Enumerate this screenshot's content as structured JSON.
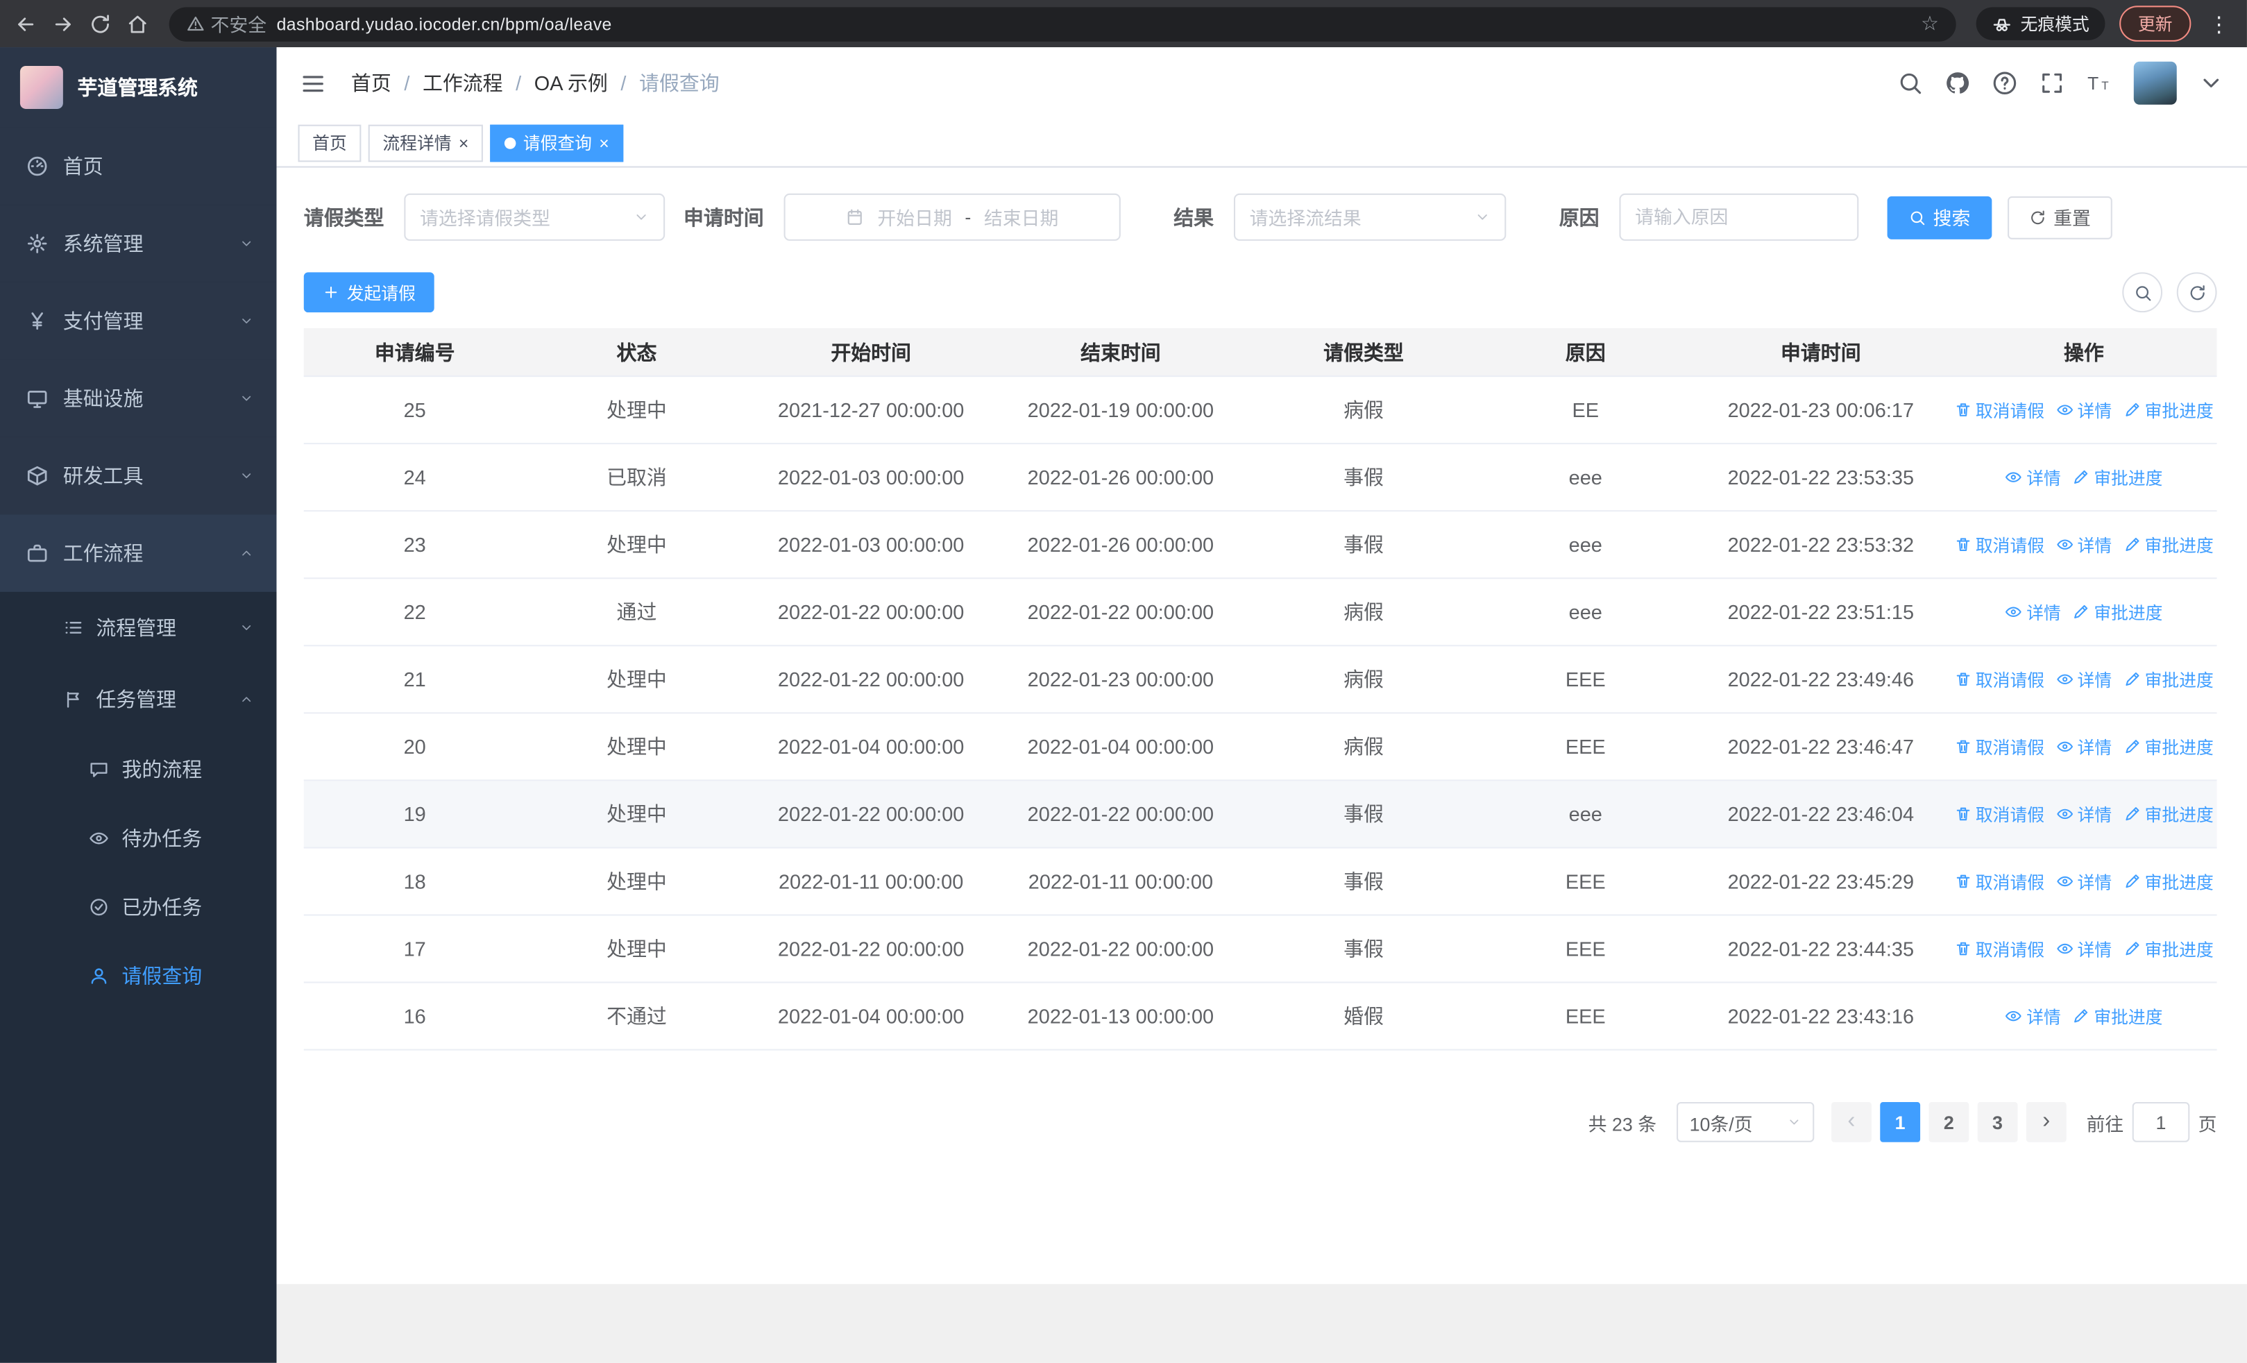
{
  "browser": {
    "security_label": "不安全",
    "url": "dashboard.yudao.iocoder.cn/bpm/oa/leave",
    "incognito_label": "无痕模式",
    "update_label": "更新"
  },
  "sidebar": {
    "logo_title": "芋道管理系统",
    "items": [
      {
        "label": "首页"
      },
      {
        "label": "系统管理"
      },
      {
        "label": "支付管理"
      },
      {
        "label": "基础设施"
      },
      {
        "label": "研发工具"
      },
      {
        "label": "工作流程"
      }
    ],
    "submenu": {
      "process_mgmt": "流程管理",
      "task_mgmt": "任务管理",
      "my_process": "我的流程",
      "todo_tasks": "待办任务",
      "done_tasks": "已办任务",
      "leave_query": "请假查询"
    }
  },
  "header": {
    "breadcrumb": [
      "首页",
      "工作流程",
      "OA 示例",
      "请假查询"
    ],
    "separator": "/"
  },
  "tabs": [
    {
      "label": "首页"
    },
    {
      "label": "流程详情"
    },
    {
      "label": "请假查询"
    }
  ],
  "filters": {
    "leave_type_label": "请假类型",
    "leave_type_placeholder": "请选择请假类型",
    "apply_time_label": "申请时间",
    "start_date_placeholder": "开始日期",
    "date_separator": "-",
    "end_date_placeholder": "结束日期",
    "result_label": "结果",
    "result_placeholder": "请选择流结果",
    "reason_label": "原因",
    "reason_placeholder": "请输入原因",
    "search_label": "搜索",
    "reset_label": "重置"
  },
  "toolbar": {
    "create_label": "发起请假"
  },
  "table": {
    "columns": [
      "申请编号",
      "状态",
      "开始时间",
      "结束时间",
      "请假类型",
      "原因",
      "申请时间",
      "操作"
    ],
    "action_labels": {
      "cancel": "取消请假",
      "detail": "详情",
      "progress": "审批进度"
    },
    "rows": [
      {
        "id": "25",
        "status": "处理中",
        "start": "2021-12-27 00:00:00",
        "end": "2022-01-19 00:00:00",
        "type": "病假",
        "reason": "EE",
        "applied": "2022-01-23 00:06:17",
        "cancelable": true,
        "highlight": false
      },
      {
        "id": "24",
        "status": "已取消",
        "start": "2022-01-03 00:00:00",
        "end": "2022-01-26 00:00:00",
        "type": "事假",
        "reason": "eee",
        "applied": "2022-01-22 23:53:35",
        "cancelable": false,
        "highlight": false
      },
      {
        "id": "23",
        "status": "处理中",
        "start": "2022-01-03 00:00:00",
        "end": "2022-01-26 00:00:00",
        "type": "事假",
        "reason": "eee",
        "applied": "2022-01-22 23:53:32",
        "cancelable": true,
        "highlight": false
      },
      {
        "id": "22",
        "status": "通过",
        "start": "2022-01-22 00:00:00",
        "end": "2022-01-22 00:00:00",
        "type": "病假",
        "reason": "eee",
        "applied": "2022-01-22 23:51:15",
        "cancelable": false,
        "highlight": false
      },
      {
        "id": "21",
        "status": "处理中",
        "start": "2022-01-22 00:00:00",
        "end": "2022-01-23 00:00:00",
        "type": "病假",
        "reason": "EEE",
        "applied": "2022-01-22 23:49:46",
        "cancelable": true,
        "highlight": false
      },
      {
        "id": "20",
        "status": "处理中",
        "start": "2022-01-04 00:00:00",
        "end": "2022-01-04 00:00:00",
        "type": "病假",
        "reason": "EEE",
        "applied": "2022-01-22 23:46:47",
        "cancelable": true,
        "highlight": false
      },
      {
        "id": "19",
        "status": "处理中",
        "start": "2022-01-22 00:00:00",
        "end": "2022-01-22 00:00:00",
        "type": "事假",
        "reason": "eee",
        "applied": "2022-01-22 23:46:04",
        "cancelable": true,
        "highlight": true
      },
      {
        "id": "18",
        "status": "处理中",
        "start": "2022-01-11 00:00:00",
        "end": "2022-01-11 00:00:00",
        "type": "事假",
        "reason": "EEE",
        "applied": "2022-01-22 23:45:29",
        "cancelable": true,
        "highlight": false
      },
      {
        "id": "17",
        "status": "处理中",
        "start": "2022-01-22 00:00:00",
        "end": "2022-01-22 00:00:00",
        "type": "事假",
        "reason": "EEE",
        "applied": "2022-01-22 23:44:35",
        "cancelable": true,
        "highlight": false
      },
      {
        "id": "16",
        "status": "不通过",
        "start": "2022-01-04 00:00:00",
        "end": "2022-01-13 00:00:00",
        "type": "婚假",
        "reason": "EEE",
        "applied": "2022-01-22 23:43:16",
        "cancelable": false,
        "highlight": false
      }
    ]
  },
  "pagination": {
    "total": "共 23 条",
    "page_size": "10条/页",
    "pages": [
      "1",
      "2",
      "3"
    ],
    "goto_label": "前往",
    "goto_value": "1",
    "page_unit": "页"
  },
  "icons": {
    "close": "×",
    "prev": "‹",
    "next": "›",
    "menu_dots": "⋮",
    "star": "☆"
  },
  "colors": {
    "accent": "#409eff"
  }
}
